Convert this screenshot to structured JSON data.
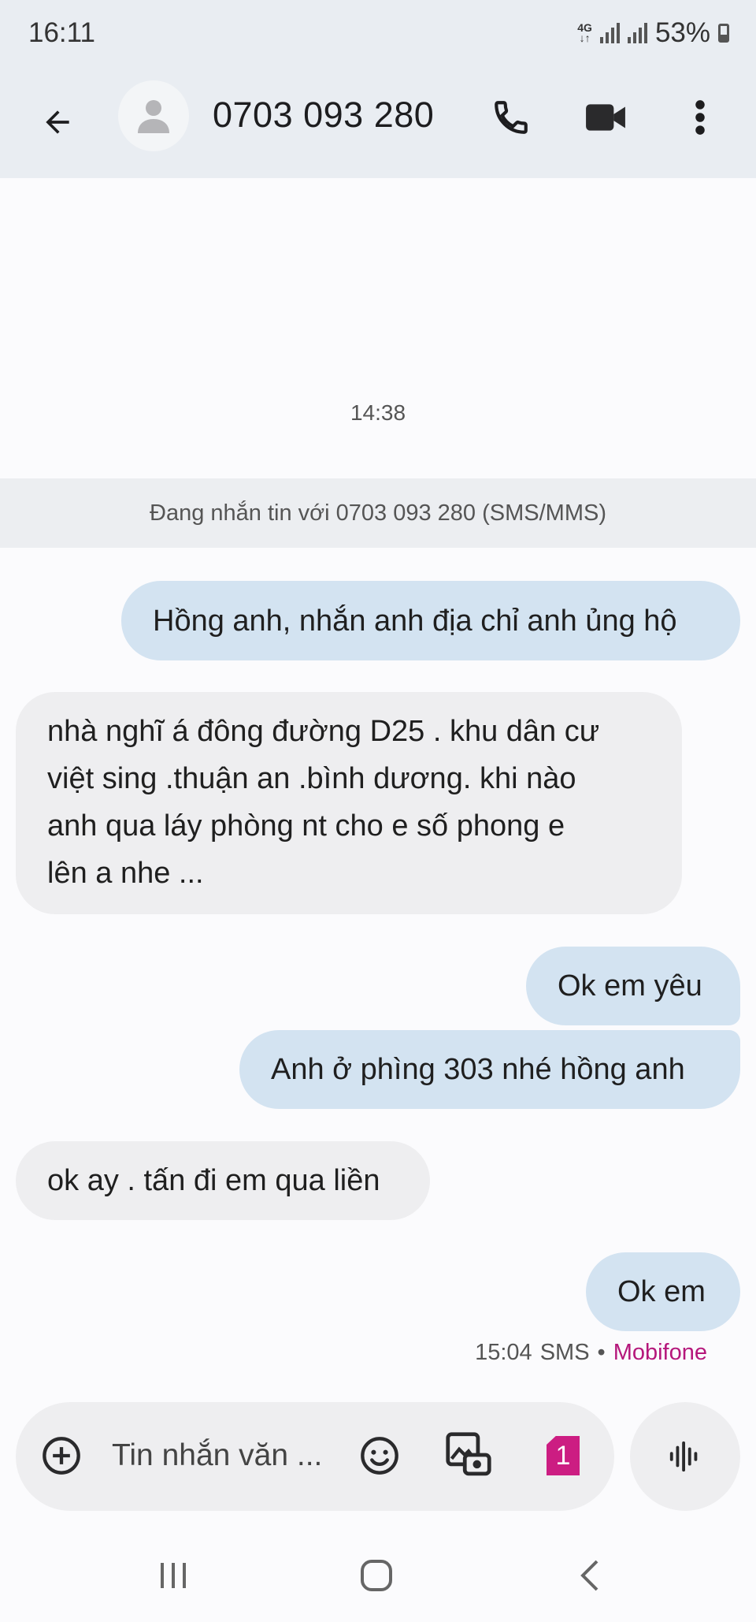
{
  "status_bar": {
    "time": "16:11",
    "network": "4G",
    "battery": "53%"
  },
  "header": {
    "contact": "0703 093 280",
    "icons": [
      "back-arrow-icon",
      "person-icon",
      "phone-icon",
      "video-camera-icon",
      "more-vert-icon"
    ]
  },
  "conversation": {
    "timestamp": "14:38",
    "info_banner": "Đang nhắn tin với 0703 093 280 (SMS/MMS)",
    "messages": [
      {
        "direction": "outgoing",
        "text": "Hồng anh, nhắn anh địa chỉ anh ủng hộ"
      },
      {
        "direction": "incoming",
        "text": "nhà nghĩ á đông đường D25 . khu dân cư\nviệt sing .thuận an .bình dương. khi nào\nanh qua láy phòng nt cho e số phong e\nlên a nhe ..."
      },
      {
        "direction": "outgoing",
        "text": "Ok em yêu"
      },
      {
        "direction": "outgoing",
        "text": "Anh ở phìng 303 nhé hồng anh"
      },
      {
        "direction": "incoming",
        "text": "ok ay . tấn đi em qua liền"
      },
      {
        "direction": "outgoing",
        "text": "Ok em"
      }
    ],
    "last_meta": {
      "time": "15:04",
      "type": "SMS",
      "separator": "•",
      "carrier": "Mobifone"
    }
  },
  "composer": {
    "placeholder": "Tin nhắn văn ...",
    "sim_slot": "1"
  },
  "colors": {
    "outgoing_bubble": "#d3e3f1",
    "incoming_bubble": "#eeeef0",
    "carrier_accent": "#b5177b",
    "sim_badge": "#cc1d82"
  }
}
